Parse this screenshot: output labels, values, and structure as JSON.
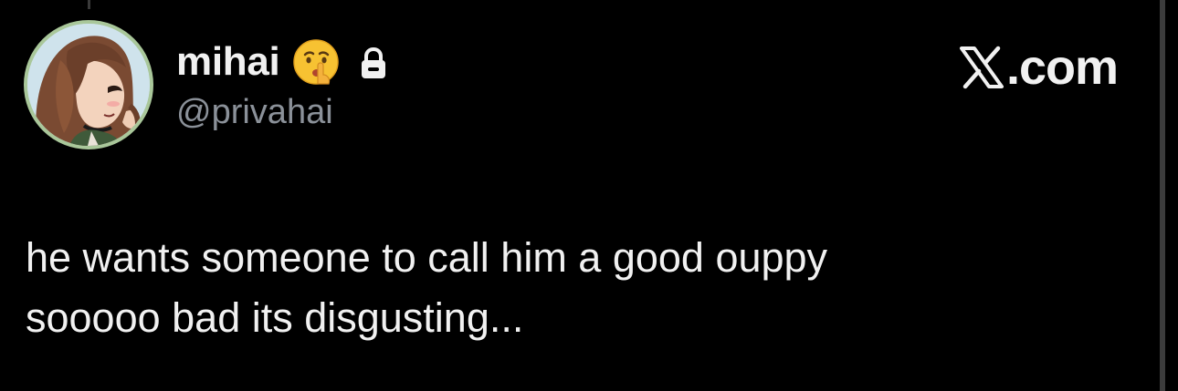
{
  "author": {
    "display_name": "mihai",
    "handle": "@privahai",
    "avatar_icon": "anime-girl-avatar",
    "badge_emoji_icon": "shushing-face-emoji",
    "protected_icon": "lock-icon"
  },
  "brand": {
    "x_logo_icon": "x-logo-icon",
    "text": ".com"
  },
  "tweet": {
    "text": "he wants someone to call him a good ouppy\nsooooo bad its disgusting..."
  },
  "colors": {
    "background": "#000000",
    "text_primary": "#f1f1f1",
    "text_secondary": "#8b9199",
    "avatar_ring": "#a9c79a"
  }
}
